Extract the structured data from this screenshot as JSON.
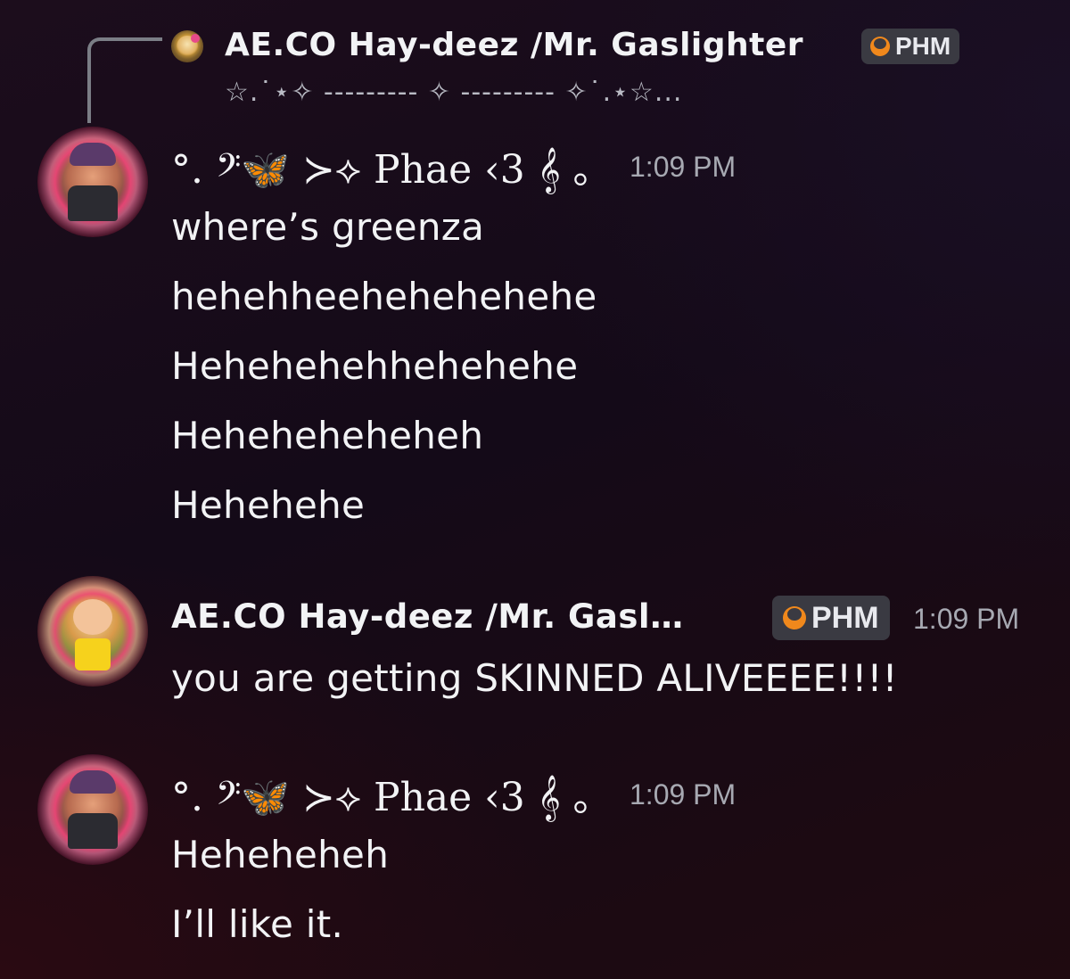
{
  "reply": {
    "author": "AE.CO Hay-deez /Mr. Gaslighter",
    "tag": "PHM",
    "preview": "☆.˙⋆✧ --------- ✧ --------- ✧˙.⋆☆..."
  },
  "messages": [
    {
      "author": "°. 𝄢🦋 ≻⟡ Phae ‹3 𝄞 ｡",
      "avatar": "avatar-phae",
      "time": "1:09 PM",
      "lines": [
        "where’s greenza",
        "hehehheehehehehehe",
        "Hehehehehhehehehe",
        "Heheheheheheh",
        "Hehehehe"
      ]
    },
    {
      "author": "AE.CO Hay-deez /Mr. Gasl…",
      "tag": "PHM",
      "avatar": "avatar-haydeez",
      "time": "1:09 PM",
      "lines": [
        "you are getting SKINNED ALIVEEEE!!!!"
      ]
    },
    {
      "author": "°. 𝄢🦋 ≻⟡ Phae ‹3 𝄞 ｡",
      "avatar": "avatar-phae",
      "time": "1:09 PM",
      "lines": [
        "Heheheheh",
        "I’ll like it."
      ]
    }
  ]
}
